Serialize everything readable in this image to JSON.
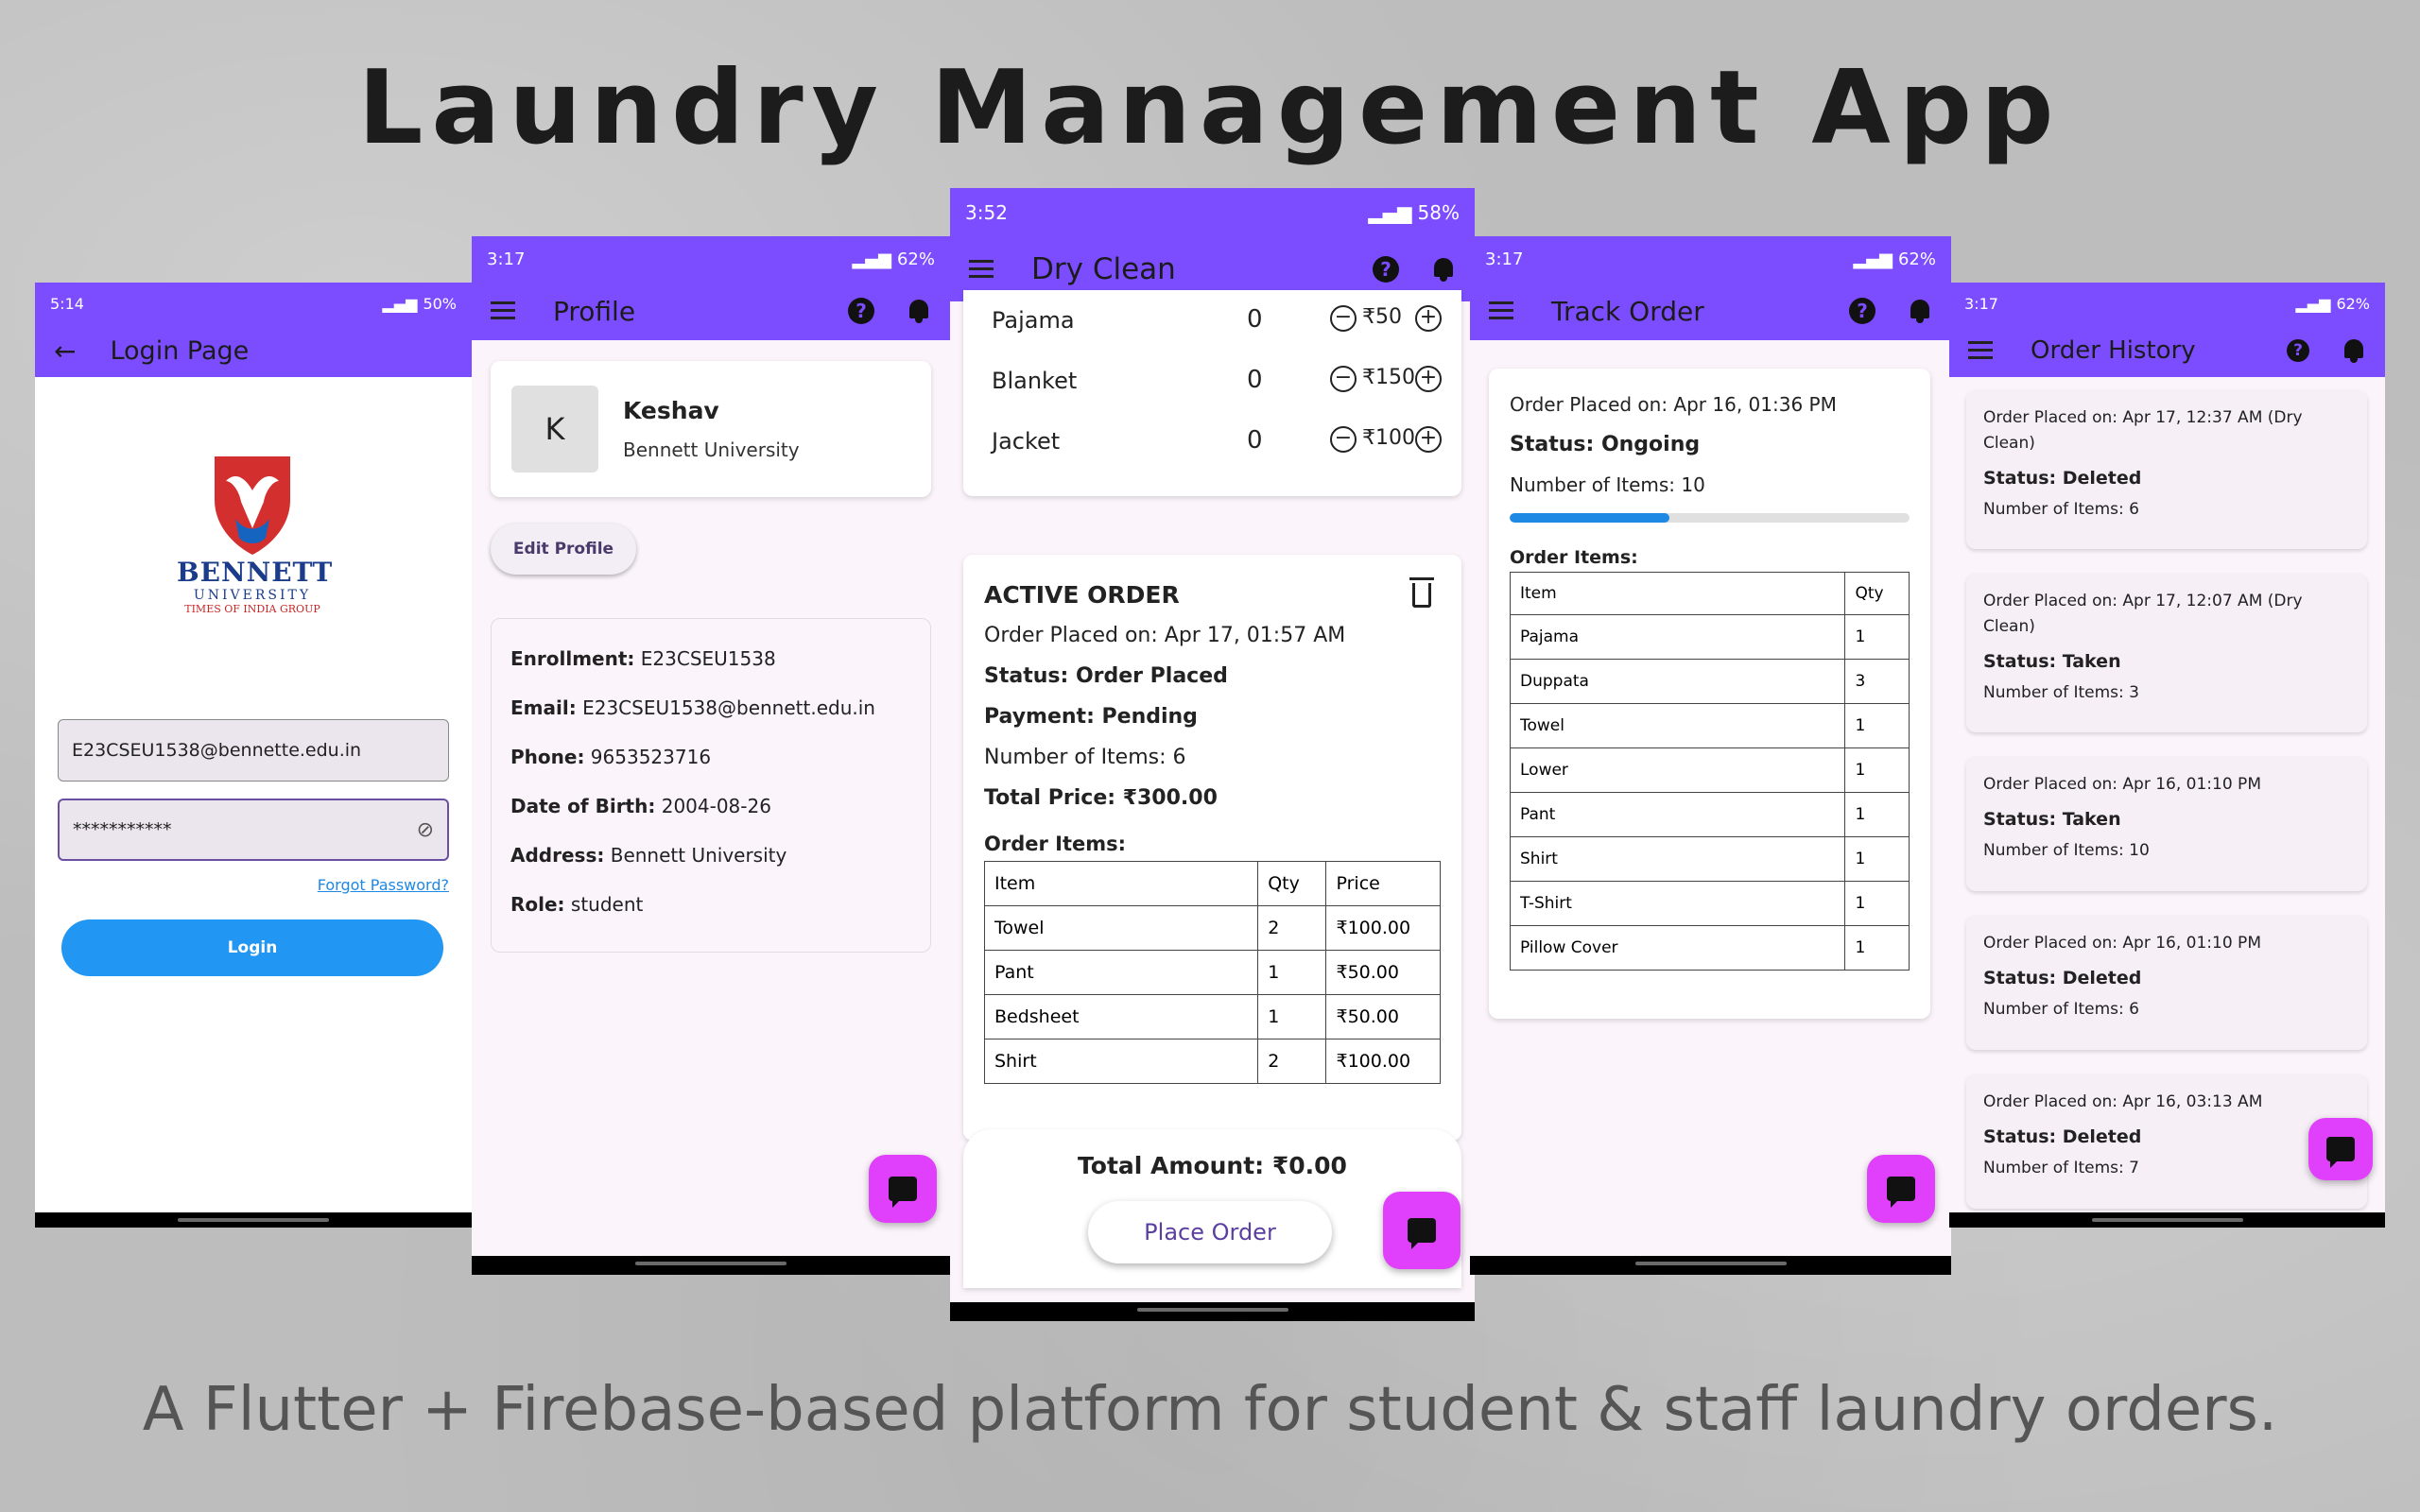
{
  "headline": "Laundry Management App",
  "tagline": "A Flutter + Firebase-based platform for student & staff laundry orders.",
  "colors": {
    "accent": "#7c4dff",
    "fab": "#e040fb",
    "login_button": "#2196f3",
    "progress": "#1e88e5"
  },
  "login": {
    "time": "5:14",
    "battery": "50%",
    "title": "Login Page",
    "logo_name": "BENNETT",
    "logo_sub": "UNIVERSITY",
    "logo_group": "TIMES OF INDIA GROUP",
    "email_value": "E23CSEU1538@bennette.edu.in",
    "password_value": "***********",
    "forgot": "Forgot Password?",
    "login_button": "Login"
  },
  "profile": {
    "time": "3:17",
    "battery": "62%",
    "title": "Profile",
    "avatar_letter": "K",
    "name": "Keshav",
    "org": "Bennett University",
    "edit_button": "Edit Profile",
    "fields": [
      {
        "label": "Enrollment:",
        "value": "E23CSEU1538"
      },
      {
        "label": "Email:",
        "value": "E23CSEU1538@bennett.edu.in"
      },
      {
        "label": "Phone:",
        "value": "9653523716"
      },
      {
        "label": "Date of Birth:",
        "value": "2004-08-26"
      },
      {
        "label": "Address:",
        "value": "Bennett University"
      },
      {
        "label": "Role:",
        "value": "student"
      }
    ]
  },
  "dryclean": {
    "time": "3:52",
    "battery": "58%",
    "title": "Dry Clean",
    "items": [
      {
        "name": "Pajama",
        "qty": "0",
        "price": "₹50"
      },
      {
        "name": "Blanket",
        "qty": "0",
        "price": "₹150"
      },
      {
        "name": "Jacket",
        "qty": "0",
        "price": "₹100"
      }
    ],
    "active_title": "ACTIVE ORDER",
    "placed": "Order Placed on: Apr 17, 01:57 AM",
    "status": "Status: Order Placed",
    "payment": "Payment: Pending",
    "num_items": "Number of Items: 6",
    "total_price": "Total Price: ₹300.00",
    "order_items_label": "Order Items:",
    "table_headers": [
      "Item",
      "Qty",
      "Price"
    ],
    "table_rows": [
      [
        "Towel",
        "2",
        "₹100.00"
      ],
      [
        "Pant",
        "1",
        "₹50.00"
      ],
      [
        "Bedsheet",
        "1",
        "₹50.00"
      ],
      [
        "Shirt",
        "2",
        "₹100.00"
      ]
    ],
    "total_amount": "Total Amount: ₹0.00",
    "place_order": "Place Order"
  },
  "track": {
    "time": "3:17",
    "battery": "62%",
    "title": "Track Order",
    "placed": "Order Placed on: Apr 16, 01:36 PM",
    "status": "Status: Ongoing",
    "num_items": "Number of Items: 10",
    "progress_fraction": 0.4,
    "order_items_label": "Order Items:",
    "table_headers": [
      "Item",
      "Qty"
    ],
    "table_rows": [
      [
        "Pajama",
        "1"
      ],
      [
        "Duppata",
        "3"
      ],
      [
        "Towel",
        "1"
      ],
      [
        "Lower",
        "1"
      ],
      [
        "Pant",
        "1"
      ],
      [
        "Shirt",
        "1"
      ],
      [
        "T-Shirt",
        "1"
      ],
      [
        "Pillow Cover",
        "1"
      ]
    ]
  },
  "history": {
    "time": "3:17",
    "battery": "62%",
    "title": "Order History",
    "orders": [
      {
        "placed": "Order Placed on: Apr 17, 12:37 AM (Dry Clean)",
        "status": "Status: Deleted",
        "items": "Number of Items: 6"
      },
      {
        "placed": "Order Placed on: Apr 17, 12:07 AM (Dry Clean)",
        "status": "Status: Taken",
        "items": "Number of Items: 3"
      },
      {
        "placed": "Order Placed on: Apr 16, 01:10 PM",
        "status": "Status: Taken",
        "items": "Number of Items: 10"
      },
      {
        "placed": "Order Placed on: Apr 16, 01:10 PM",
        "status": "Status: Deleted",
        "items": "Number of Items: 6"
      },
      {
        "placed": "Order Placed on: Apr 16, 03:13 AM",
        "status": "Status: Deleted",
        "items": "Number of Items: 7"
      }
    ]
  }
}
